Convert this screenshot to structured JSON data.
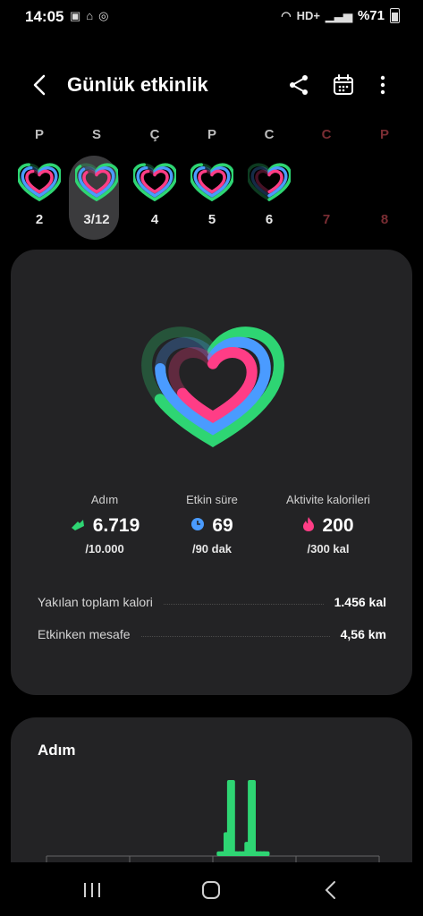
{
  "status_bar": {
    "time": "14:05",
    "left_icons": [
      "image-icon",
      "mosque-icon",
      "whatsapp-icon"
    ],
    "network": "HD+",
    "battery": "%71"
  },
  "header": {
    "title": "Günlük etkinlik"
  },
  "week": [
    {
      "letter": "P",
      "num": "2",
      "state": "past",
      "progress": 0.9
    },
    {
      "letter": "S",
      "num": "3/12",
      "state": "selected",
      "progress": 0.85
    },
    {
      "letter": "Ç",
      "num": "4",
      "state": "past",
      "progress": 0.9
    },
    {
      "letter": "P",
      "num": "5",
      "state": "past",
      "progress": 0.9
    },
    {
      "letter": "C",
      "num": "6",
      "state": "past",
      "progress": 0.5
    },
    {
      "letter": "C",
      "num": "7",
      "state": "future",
      "progress": 0
    },
    {
      "letter": "P",
      "num": "8",
      "state": "future",
      "progress": 0
    }
  ],
  "summary": {
    "metrics": [
      {
        "label": "Adım",
        "value": "6.719",
        "goal": "/10.000",
        "icon": "shoe-icon",
        "color": "#2ed573",
        "progress": 0.672
      },
      {
        "label": "Etkin süre",
        "value": "69",
        "goal": "/90 dak",
        "icon": "clock-icon",
        "color": "#4a9bff",
        "progress": 0.767
      },
      {
        "label": "Aktivite kalorileri",
        "value": "200",
        "goal": "/300 kal",
        "icon": "flame-icon",
        "color": "#ff3d86",
        "progress": 0.667
      }
    ],
    "total_calories": {
      "label": "Yakılan toplam kalori",
      "value": "1.456  kal"
    },
    "active_distance": {
      "label": "Etkinken mesafe",
      "value": "4,56  km"
    }
  },
  "steps_card": {
    "title": "Adım",
    "chart_data": {
      "type": "bar",
      "values": [
        0,
        0,
        0,
        0,
        0,
        0,
        0,
        0,
        0,
        0,
        0,
        0,
        0,
        0,
        0,
        0,
        0,
        0,
        0,
        0,
        0,
        0,
        0,
        0,
        0,
        0,
        0,
        0,
        0,
        0,
        0,
        0,
        0,
        0,
        0,
        0,
        0,
        0,
        0,
        0,
        0,
        0,
        0,
        0,
        0,
        0,
        0,
        0,
        0,
        5,
        5,
        25,
        80,
        5,
        5,
        5,
        5,
        15,
        80,
        5,
        5,
        5,
        5,
        0,
        0,
        0,
        0,
        0,
        0,
        0,
        0,
        0,
        0,
        0,
        0,
        0,
        0,
        0,
        0,
        0,
        0,
        0,
        0,
        0,
        0,
        0,
        0,
        0,
        0,
        0,
        0,
        0,
        0,
        0,
        0,
        0
      ],
      "color": "#2ed573"
    }
  },
  "colors": {
    "green": "#2ed573",
    "blue": "#4a9bff",
    "pink": "#ff3d86",
    "card": "#232325"
  }
}
